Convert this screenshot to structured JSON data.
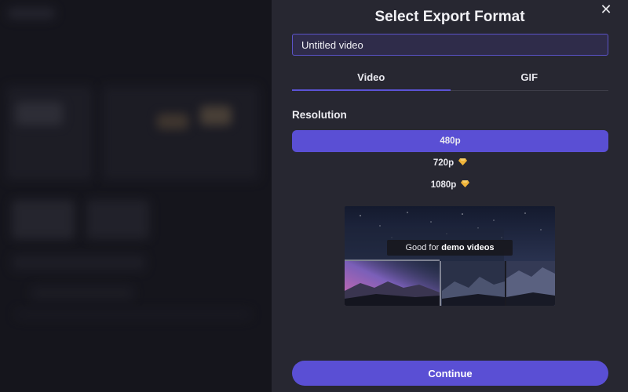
{
  "dialog": {
    "title": "Select Export Format",
    "close_icon": "close-icon",
    "filename_value": "Untitled video",
    "tabs": [
      {
        "label": "Video",
        "active": true
      },
      {
        "label": "GIF",
        "active": false
      }
    ],
    "resolution_label": "Resolution",
    "resolutions": [
      {
        "label": "480p",
        "selected": true,
        "premium": false
      },
      {
        "label": "720p",
        "selected": false,
        "premium": true,
        "icon": "gem-icon"
      },
      {
        "label": "1080p",
        "selected": false,
        "premium": true,
        "icon": "gem-icon"
      }
    ],
    "preview": {
      "badge_prefix": "Good for ",
      "badge_emphasis": "demo videos"
    },
    "continue_label": "Continue"
  },
  "colors": {
    "accent": "#5a4fd4",
    "panel_bg": "#272731",
    "premium_gem": "#f0b43a"
  }
}
